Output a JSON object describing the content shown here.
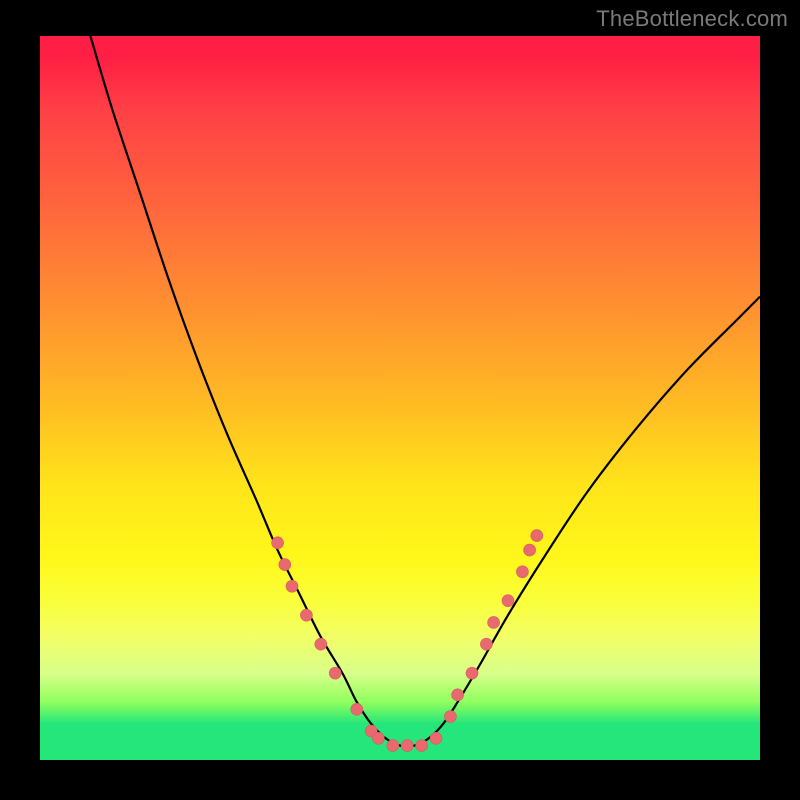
{
  "watermark": "TheBottleneck.com",
  "chart_data": {
    "type": "line",
    "title": "",
    "xlabel": "",
    "ylabel": "",
    "xlim": [
      0,
      100
    ],
    "ylim": [
      0,
      100
    ],
    "gradient_background": {
      "direction": "vertical",
      "stops": [
        {
          "pos": 0,
          "color": "#ff1f44"
        },
        {
          "pos": 25,
          "color": "#ff6a3c"
        },
        {
          "pos": 52,
          "color": "#ffbf22"
        },
        {
          "pos": 72,
          "color": "#fff71a"
        },
        {
          "pos": 92,
          "color": "#8fff5e"
        },
        {
          "pos": 100,
          "color": "#25e67a"
        }
      ]
    },
    "series": [
      {
        "name": "bottleneck-curve",
        "color": "#000000",
        "x": [
          7,
          10,
          14,
          18,
          22,
          26,
          30,
          33,
          36,
          39,
          42,
          44,
          46,
          48,
          50,
          52,
          54,
          56,
          58,
          61,
          65,
          70,
          76,
          83,
          90,
          97,
          100
        ],
        "y": [
          100,
          90,
          78,
          66,
          55,
          45,
          36,
          29,
          23,
          17,
          12,
          8,
          5,
          3,
          2,
          2,
          3,
          5,
          8,
          13,
          20,
          28,
          37,
          46,
          54,
          61,
          64
        ]
      }
    ],
    "markers": {
      "name": "highlight-points",
      "color": "#e86a6f",
      "radius": 6,
      "points": [
        {
          "x": 33,
          "y": 30
        },
        {
          "x": 34,
          "y": 27
        },
        {
          "x": 35,
          "y": 24
        },
        {
          "x": 37,
          "y": 20
        },
        {
          "x": 39,
          "y": 16
        },
        {
          "x": 41,
          "y": 12
        },
        {
          "x": 44,
          "y": 7
        },
        {
          "x": 46,
          "y": 4
        },
        {
          "x": 47,
          "y": 3
        },
        {
          "x": 49,
          "y": 2
        },
        {
          "x": 51,
          "y": 2
        },
        {
          "x": 53,
          "y": 2
        },
        {
          "x": 55,
          "y": 3
        },
        {
          "x": 57,
          "y": 6
        },
        {
          "x": 58,
          "y": 9
        },
        {
          "x": 60,
          "y": 12
        },
        {
          "x": 62,
          "y": 16
        },
        {
          "x": 63,
          "y": 19
        },
        {
          "x": 65,
          "y": 22
        },
        {
          "x": 67,
          "y": 26
        },
        {
          "x": 68,
          "y": 29
        },
        {
          "x": 69,
          "y": 31
        }
      ]
    }
  }
}
